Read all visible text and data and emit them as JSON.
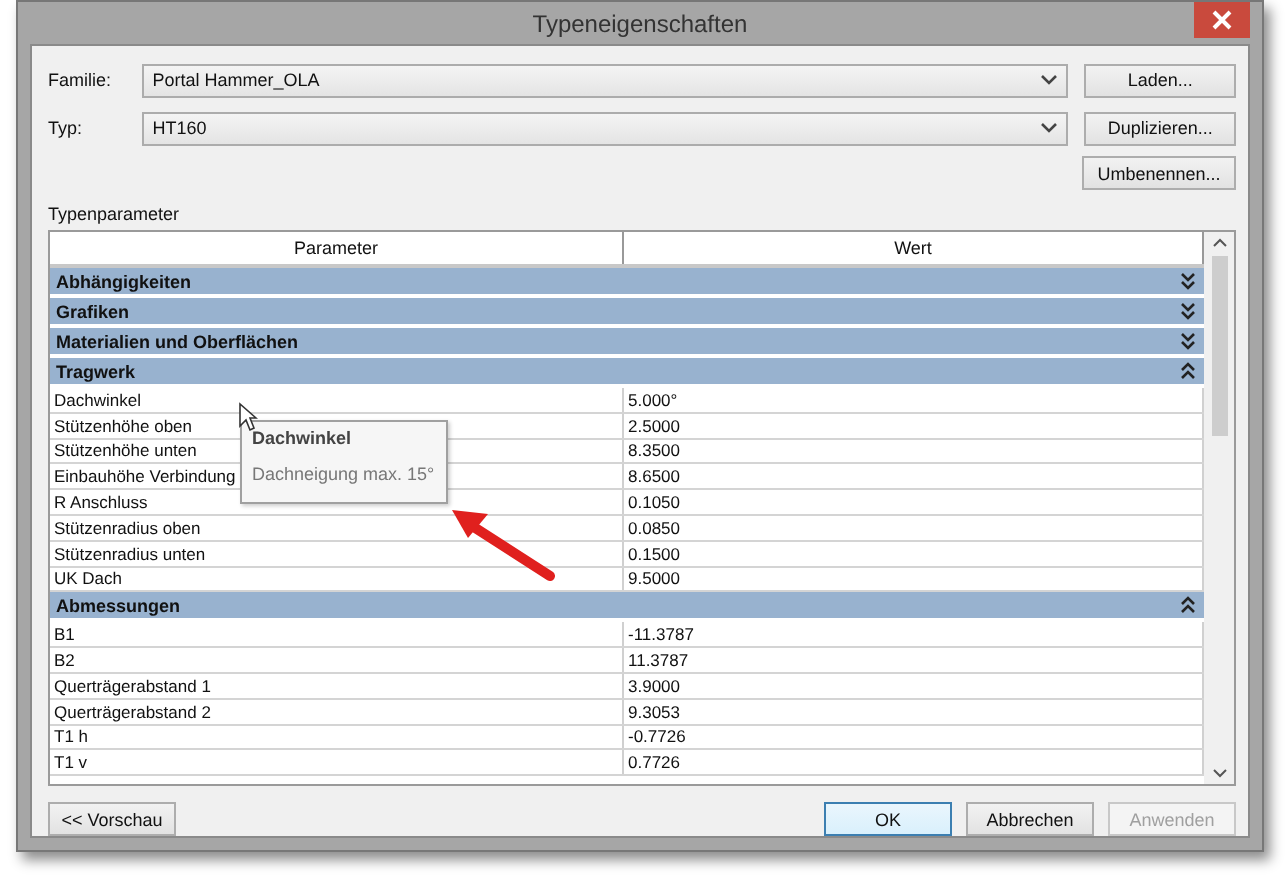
{
  "window": {
    "title": "Typeneigenschaften"
  },
  "fields": [
    {
      "label": "Familie:",
      "value": "Portal Hammer_OLA",
      "button": "Laden..."
    },
    {
      "label": "Typ:",
      "value": "HT160",
      "button": "Duplizieren..."
    }
  ],
  "extra_button": "Umbenennen...",
  "section_label": "Typenparameter",
  "table": {
    "columns": [
      "Parameter",
      "Wert"
    ],
    "groups": [
      {
        "name": "Abhängigkeiten",
        "expanded": false
      },
      {
        "name": "Grafiken",
        "expanded": false
      },
      {
        "name": "Materialien und Oberflächen",
        "expanded": false
      },
      {
        "name": "Tragwerk",
        "expanded": true,
        "rows": [
          {
            "parameter": "Dachwinkel",
            "value": "5.000°"
          },
          {
            "parameter": "Stützenhöhe oben",
            "value": "2.5000"
          },
          {
            "parameter": "Stützenhöhe unten",
            "value": "8.3500"
          },
          {
            "parameter": "Einbauhöhe Verbindung",
            "value": "8.6500"
          },
          {
            "parameter": "R Anschluss",
            "value": "0.1050"
          },
          {
            "parameter": "Stützenradius oben",
            "value": "0.0850"
          },
          {
            "parameter": "Stützenradius unten",
            "value": "0.1500"
          },
          {
            "parameter": "UK Dach",
            "value": "9.5000"
          }
        ]
      },
      {
        "name": "Abmessungen",
        "expanded": true,
        "rows": [
          {
            "parameter": "B1",
            "value": "-11.3787"
          },
          {
            "parameter": "B2",
            "value": "11.3787"
          },
          {
            "parameter": "Querträgerabstand 1",
            "value": "3.9000"
          },
          {
            "parameter": "Querträgerabstand 2",
            "value": "9.3053"
          },
          {
            "parameter": "T1 h",
            "value": "-0.7726"
          },
          {
            "parameter": "T1 v",
            "value": "0.7726"
          }
        ]
      }
    ]
  },
  "tooltip": {
    "title": "Dachwinkel",
    "text": "Dachneigung max. 15°"
  },
  "buttons": [
    {
      "label": "<< Vorschau",
      "kind": "left",
      "disabled": false
    },
    {
      "label": "OK",
      "kind": "default",
      "disabled": false
    },
    {
      "label": "Abbrechen",
      "kind": "normal",
      "disabled": false
    },
    {
      "label": "Anwenden",
      "kind": "normal",
      "disabled": true
    }
  ]
}
